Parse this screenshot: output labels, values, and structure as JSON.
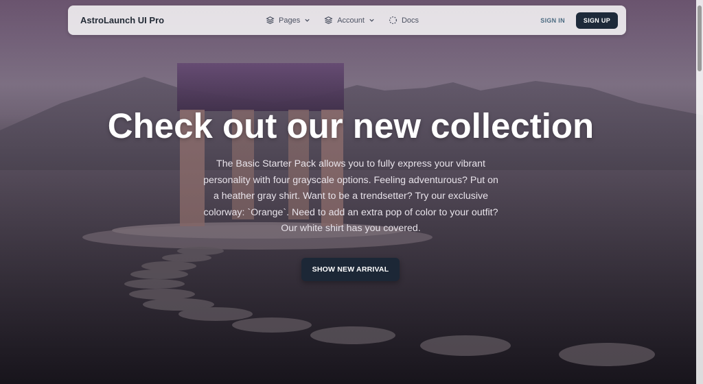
{
  "navbar": {
    "brand": "AstroLaunch UI Pro",
    "links": [
      {
        "label": "Pages",
        "icon": "stack-icon",
        "has_dropdown": true
      },
      {
        "label": "Account",
        "icon": "stack-icon",
        "has_dropdown": true
      },
      {
        "label": "Docs",
        "icon": "dashed-circle-icon",
        "has_dropdown": false
      }
    ],
    "signin_label": "SIGN IN",
    "signup_label": "SIGN UP"
  },
  "hero": {
    "title": "Check out our new collection",
    "description": "The Basic Starter Pack allows you to fully express your vibrant personality with four grayscale options. Feeling adventurous? Put on a heather gray shirt. Want to be a trendsetter? Try our exclusive colorway: `Orange`. Need to add an extra pop of color to your outfit? Our white shirt has you covered.",
    "cta_label": "SHOW NEW ARRIVAL"
  },
  "colors": {
    "accent_dark": "#1e2a3a",
    "signin_text": "#4a6a80",
    "hero_text": "#ffffff"
  }
}
